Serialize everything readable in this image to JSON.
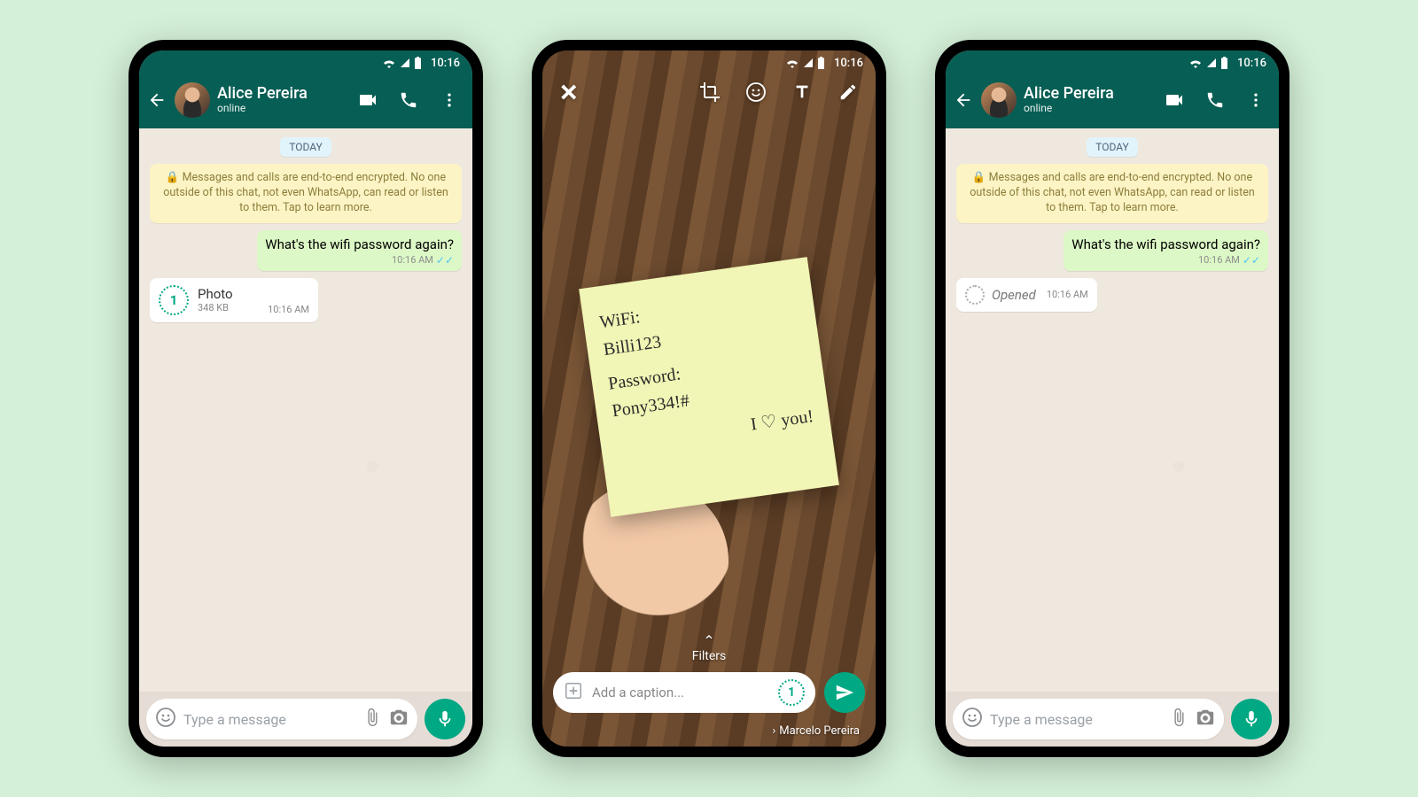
{
  "status": {
    "time": "10:16"
  },
  "contact": {
    "name": "Alice Pereira",
    "status": "online"
  },
  "chat": {
    "date_label": "TODAY",
    "e2e_text": "Messages and calls are end-to-end encrypted. No one outside of this chat, not even WhatsApp, can read or listen to them. Tap to learn more.",
    "outgoing": {
      "text": "What's the wifi password again?",
      "time": "10:16 AM"
    },
    "photo_bubble": {
      "title": "Photo",
      "size": "348 KB",
      "time": "10:16 AM"
    },
    "opened_bubble": {
      "text": "Opened",
      "time": "10:16 AM"
    },
    "input_placeholder": "Type a message"
  },
  "editor": {
    "filters_label": "Filters",
    "caption_placeholder": "Add a caption...",
    "recipient": "Marcelo Pereira",
    "note": {
      "line1": "WiFi:",
      "line2": "Billi123",
      "line3": "Password:",
      "line4": "Pony334!#",
      "line5": "I ♡ you!"
    }
  }
}
